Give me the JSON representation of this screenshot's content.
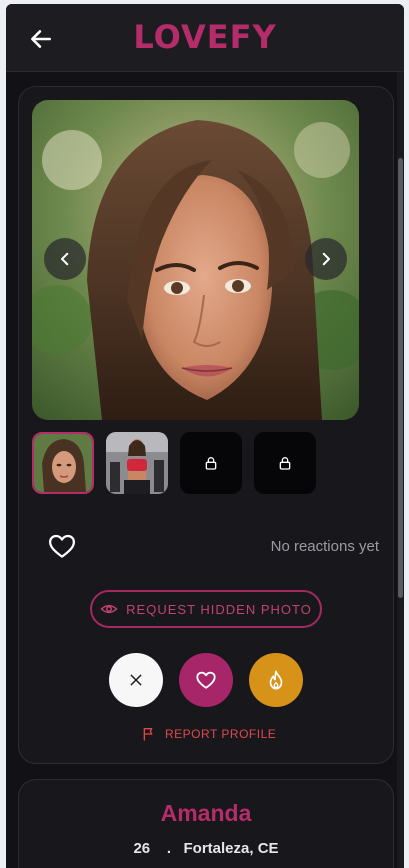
{
  "header": {
    "logo": "LOVEFY",
    "back_icon": "arrow-left-icon"
  },
  "gallery": {
    "prev_icon": "chevron-left-icon",
    "next_icon": "chevron-right-icon",
    "thumbnails": [
      {
        "type": "photo",
        "selected": true
      },
      {
        "type": "photo",
        "selected": false
      },
      {
        "type": "locked",
        "icon": "lock-icon"
      },
      {
        "type": "locked",
        "icon": "lock-icon"
      }
    ]
  },
  "reactions": {
    "icon": "heart-outline-icon",
    "status": "No reactions yet"
  },
  "request_button": {
    "label": "REQUEST HIDDEN PHOTO",
    "icon": "eye-icon"
  },
  "actions": [
    {
      "name": "pass",
      "icon": "close-icon",
      "color": "#f7f7f7"
    },
    {
      "name": "like",
      "icon": "heart-icon",
      "color": "#a7266a"
    },
    {
      "name": "superlike",
      "icon": "flame-icon",
      "color": "#d79319"
    }
  ],
  "report": {
    "label": "REPORT PROFILE",
    "icon": "flag-icon"
  },
  "profile": {
    "name": "Amanda",
    "age": "26",
    "separator": ".",
    "location": "Fortaleza, CE"
  },
  "colors": {
    "brand": "#b52c6a",
    "background": "#121216",
    "card": "#18181c",
    "danger": "#e0484d"
  }
}
